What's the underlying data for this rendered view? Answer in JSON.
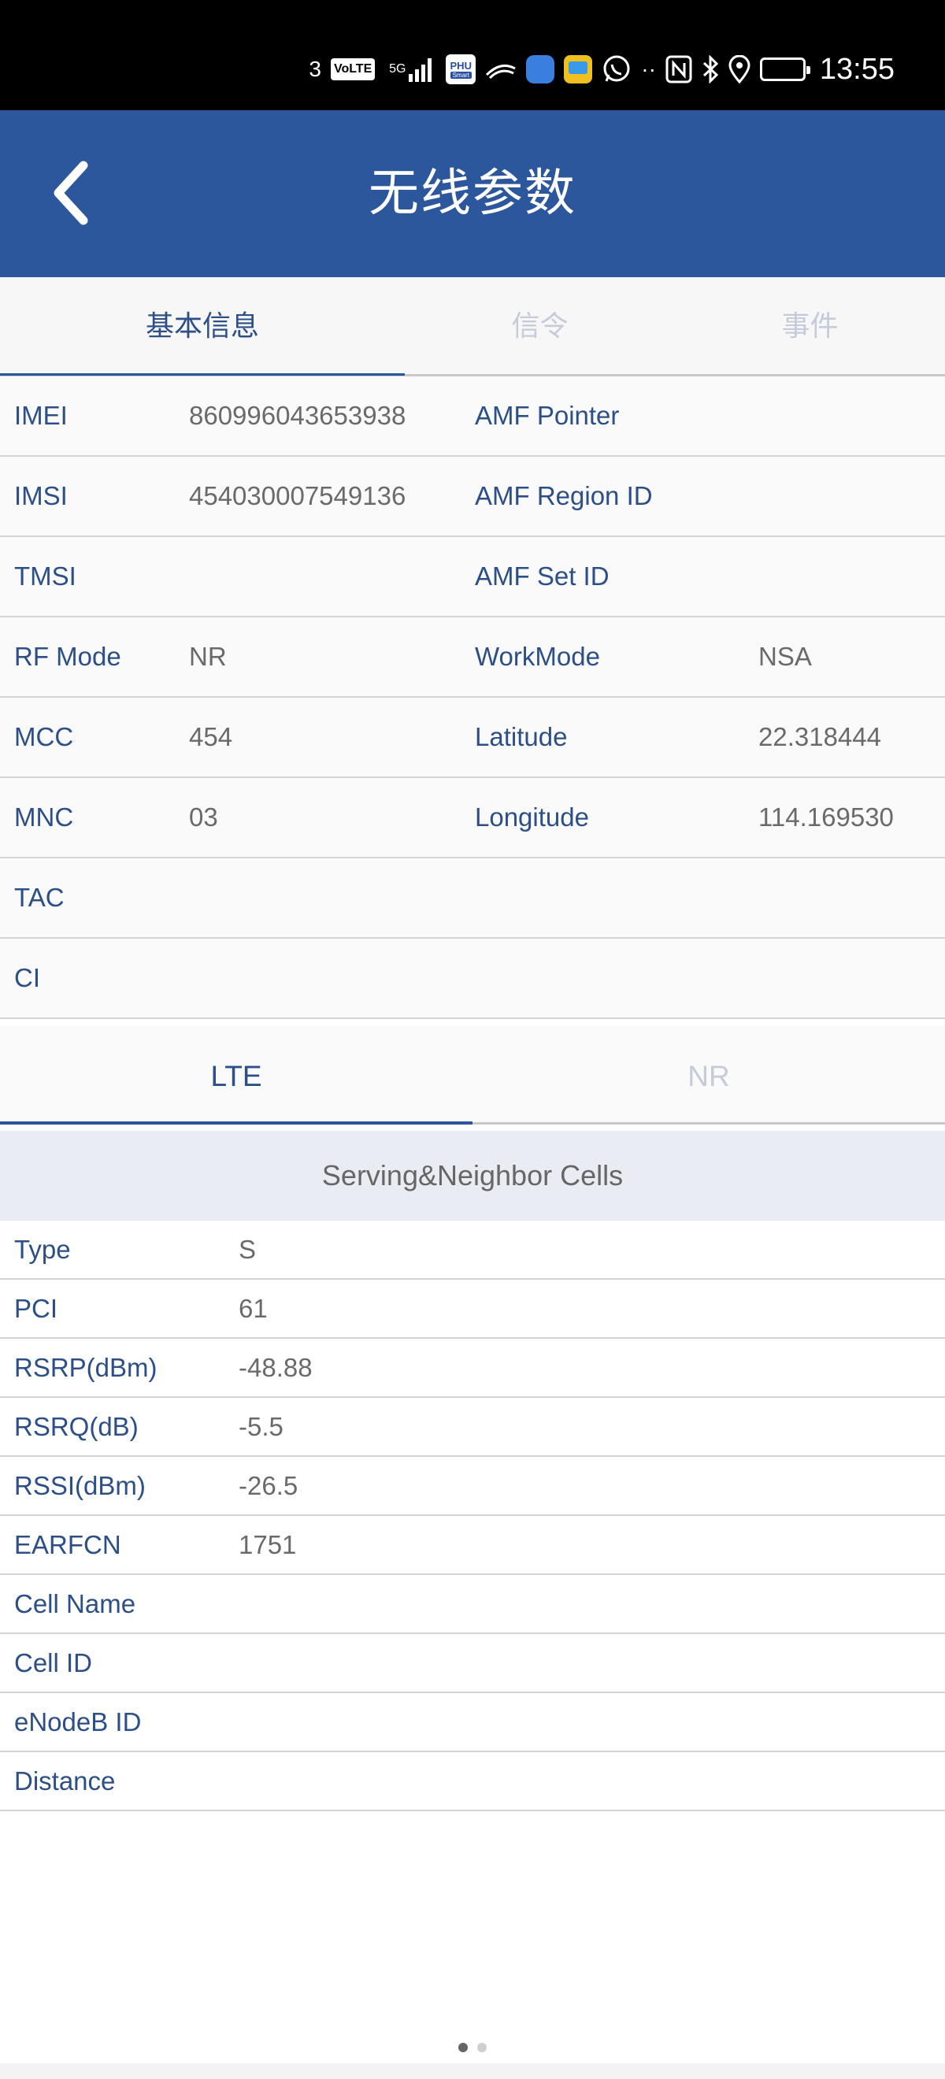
{
  "status_bar": {
    "sim_number": "3",
    "volte": "VoLTE",
    "network_5g": "5G",
    "phu": "PHU",
    "phu_sub": "Smart",
    "time": "13:55"
  },
  "header": {
    "title": "无线参数",
    "back_icon": "chevron-left-icon"
  },
  "main_tabs": [
    {
      "label": "基本信息",
      "active": true
    },
    {
      "label": "信令",
      "active": false
    },
    {
      "label": "事件",
      "active": false
    }
  ],
  "info_rows": [
    {
      "label1": "IMEI",
      "value1": "860996043653938",
      "label2": "AMF Pointer",
      "value2": ""
    },
    {
      "label1": "IMSI",
      "value1": "454030007549136",
      "label2": "AMF Region ID",
      "value2": ""
    },
    {
      "label1": "TMSI",
      "value1": "",
      "label2": "AMF Set ID",
      "value2": ""
    },
    {
      "label1": "RF Mode",
      "value1": "NR",
      "label2": "WorkMode",
      "value2": "NSA"
    },
    {
      "label1": "MCC",
      "value1": "454",
      "label2": "Latitude",
      "value2": "22.318444"
    },
    {
      "label1": "MNC",
      "value1": "03",
      "label2": "Longitude",
      "value2": "114.169530"
    },
    {
      "label1": "TAC",
      "value1": "",
      "label2": "",
      "value2": ""
    },
    {
      "label1": "CI",
      "value1": "",
      "label2": "",
      "value2": ""
    }
  ],
  "sub_tabs": [
    {
      "label": "LTE",
      "active": true
    },
    {
      "label": "NR",
      "active": false
    }
  ],
  "cells_section": {
    "title": "Serving&Neighbor Cells",
    "rows": [
      {
        "label": "Type",
        "value": "S"
      },
      {
        "label": "PCI",
        "value": "61"
      },
      {
        "label": "RSRP(dBm)",
        "value": "-48.88"
      },
      {
        "label": "RSRQ(dB)",
        "value": "-5.5"
      },
      {
        "label": "RSSI(dBm)",
        "value": "-26.5"
      },
      {
        "label": "EARFCN",
        "value": "1751"
      },
      {
        "label": "Cell Name",
        "value": ""
      },
      {
        "label": "Cell ID",
        "value": ""
      },
      {
        "label": "eNodeB ID",
        "value": ""
      },
      {
        "label": "Distance",
        "value": ""
      }
    ]
  },
  "pagination": {
    "pages": 2,
    "current": 1
  },
  "colors": {
    "header_bg": "#2d579c",
    "label_text": "#2d4f88",
    "value_text": "#6a6a6a",
    "inactive_tab": "#c5cbd8",
    "section_bg": "#e9edf3"
  }
}
